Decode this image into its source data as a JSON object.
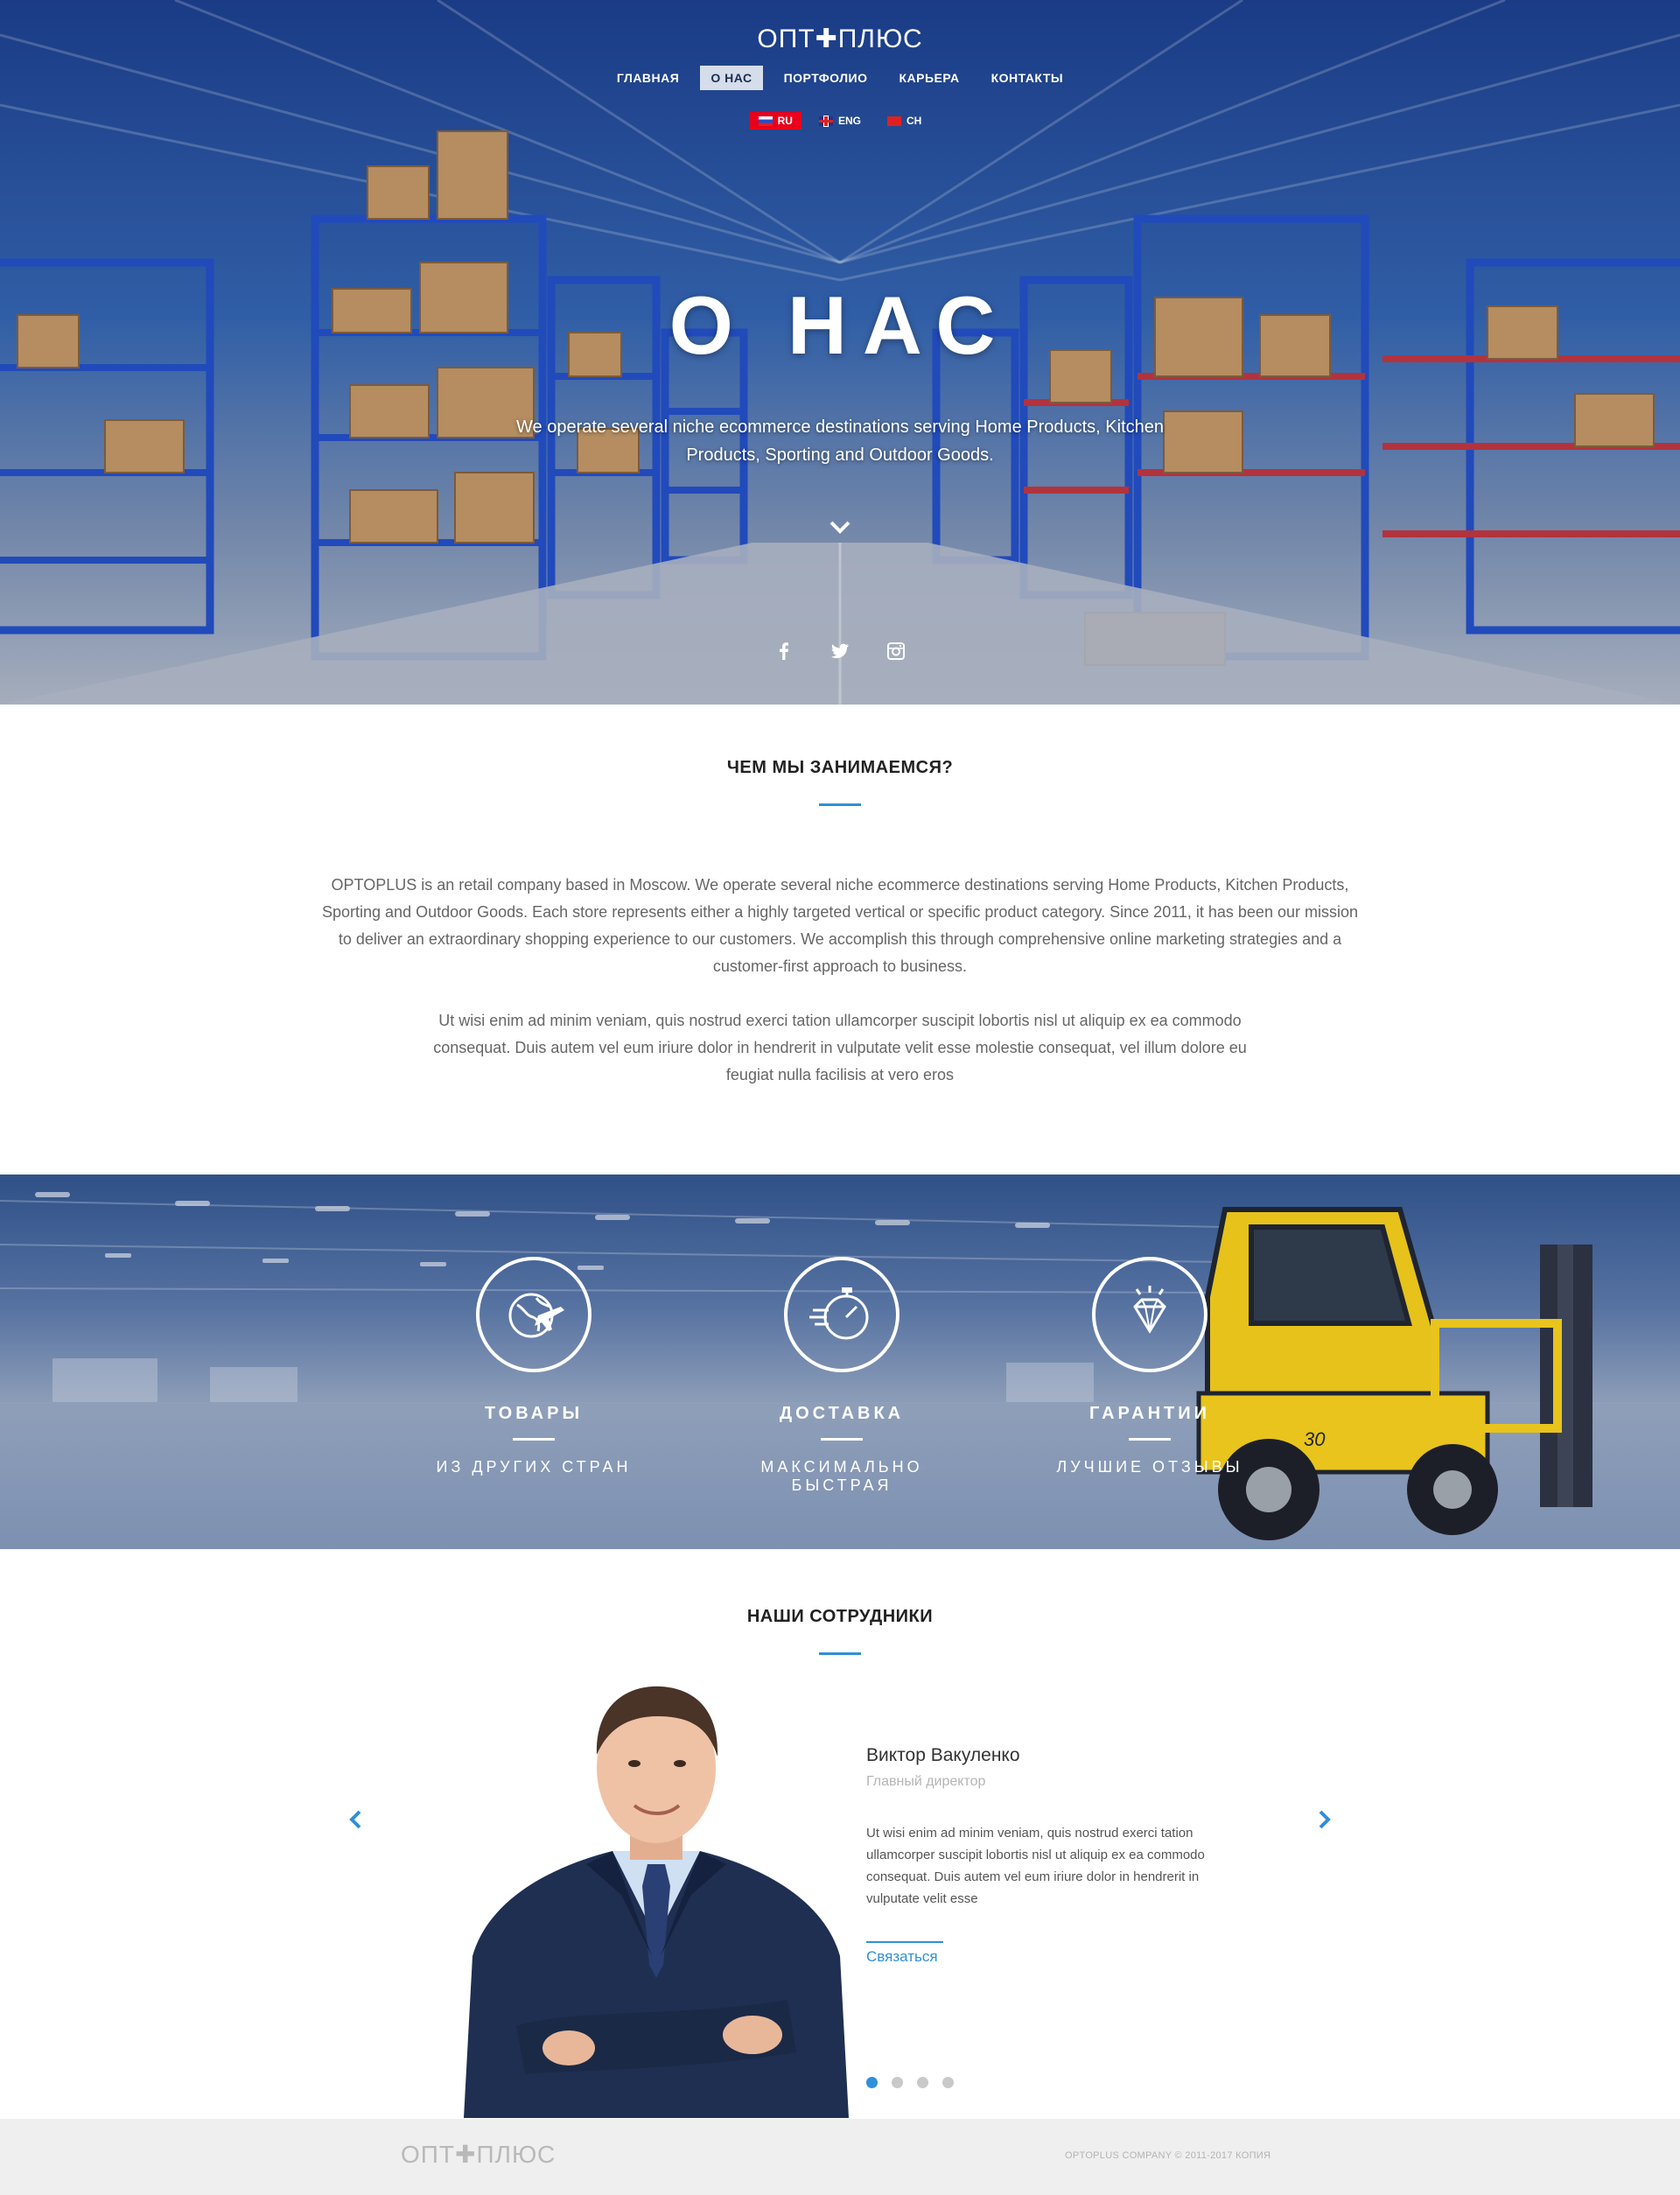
{
  "brand": {
    "logo": "ОПТ✚ПЛЮС"
  },
  "nav": {
    "items": [
      {
        "label": "ГЛАВНАЯ",
        "active": false
      },
      {
        "label": "О НАС",
        "active": true
      },
      {
        "label": "ПОРТФОЛИО",
        "active": false
      },
      {
        "label": "КАРЬЕРА",
        "active": false
      },
      {
        "label": "КОНТАКТЫ",
        "active": false
      }
    ]
  },
  "languages": [
    {
      "code": "RU",
      "flag": "flag-ru-icon",
      "active": true
    },
    {
      "code": "ENG",
      "flag": "flag-uk-icon",
      "active": false
    },
    {
      "code": "CH",
      "flag": "flag-china-icon",
      "active": false
    }
  ],
  "hero": {
    "title": "О НАС",
    "subtitle": "We operate several niche ecommerce destinations serving Home Products, Kitchen Products, Sporting and Outdoor Goods.",
    "scroll_icon": "chevron-down-icon",
    "socials": [
      "facebook-icon",
      "twitter-icon",
      "instagram-icon"
    ]
  },
  "about": {
    "title": "ЧЕМ МЫ ЗАНИМАЕМСЯ?",
    "paragraph1": "OPTOPLUS is an retail company based in Moscow. We operate several niche ecommerce destinations serving Home Products, Kitchen Products, Sporting and Outdoor Goods. Each store represents either a highly targeted vertical or specific product category. Since 2011, it has been our mission to deliver an extraordinary shopping experience to our customers. We accomplish this through comprehensive online marketing strategies and a customer-first approach to business.",
    "paragraph2": "Ut wisi enim ad minim veniam, quis nostrud exerci tation ullamcorper suscipit lobortis nisl ut aliquip ex ea commodo consequat. Duis autem vel eum iriure dolor in hendrerit in vulputate velit esse molestie consequat, vel illum dolore eu feugiat nulla facilisis at vero eros"
  },
  "features": [
    {
      "icon": "globe-plane-icon",
      "title": "ТОВАРЫ",
      "subtitle": "ИЗ ДРУГИХ СТРАН"
    },
    {
      "icon": "stopwatch-icon",
      "title": "ДОСТАВКА",
      "subtitle": "МАКСИМАЛЬНО БЫСТРАЯ"
    },
    {
      "icon": "diamond-icon",
      "title": "ГАРАНТИИ",
      "subtitle": "ЛУЧШИЕ ОТЗЫВЫ"
    }
  ],
  "team": {
    "title": "НАШИ СОТРУДНИКИ",
    "member": {
      "name": "Виктор Вакуленко",
      "role": "Главный директор",
      "bio": "Ut wisi enim ad minim veniam, quis nostrud exerci tation ullamcorper suscipit lobortis nisl ut aliquip ex ea commodo consequat. Duis autem vel eum iriure dolor in hendrerit in vulputate velit esse",
      "contact_label": "Связаться"
    },
    "prev_icon": "chevron-left-icon",
    "next_icon": "chevron-right-icon",
    "slides_total": 4,
    "slide_active": 1
  },
  "footer": {
    "logo": "ОПТ✚ПЛЮС",
    "copyright": "OPTOPLUS COMPANY © 2011-2017 КОПИЯ"
  },
  "colors": {
    "accent": "#2f8fd8",
    "lang_active": "#e8001c",
    "footer_bg": "#efefef"
  }
}
